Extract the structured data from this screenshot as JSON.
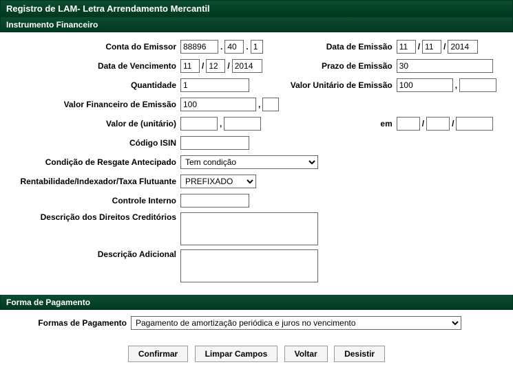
{
  "title": "Registro de LAM- Letra Arrendamento Mercantil",
  "sections": {
    "instrumento": "Instrumento Financeiro",
    "pagamento": "Forma de Pagamento"
  },
  "labels": {
    "conta_emissor": "Conta do Emissor",
    "data_emissao": "Data de Emissão",
    "data_vencimento": "Data de Vencimento",
    "prazo_emissao": "Prazo de Emissão",
    "quantidade": "Quantidade",
    "valor_unitario_emissao": "Valor Unitário de Emissão",
    "valor_financeiro_emissao": "Valor Financeiro de Emissão",
    "valor_de_unitario": "Valor de (unitário)",
    "em": "em",
    "codigo_isin": "Código ISIN",
    "condicao_resgate": "Condição de Resgate Antecipado",
    "rentabilidade": "Rentabilidade/Indexador/Taxa Flutuante",
    "controle_interno": "Controle Interno",
    "descricao_direitos": "Descrição dos Direitos Creditórios",
    "descricao_adicional": "Descrição Adicional",
    "formas_pagamento": "Formas de Pagamento"
  },
  "values": {
    "conta_emissor": {
      "p1": "88896",
      "p2": "40",
      "p3": "1"
    },
    "data_emissao": {
      "d": "11",
      "m": "11",
      "y": "2014"
    },
    "data_vencimento": {
      "d": "11",
      "m": "12",
      "y": "2014"
    },
    "prazo_emissao": "30",
    "quantidade": "1",
    "valor_unitario_emissao": {
      "int": "100",
      "dec": ""
    },
    "valor_financeiro_emissao": {
      "int": "100",
      "dec": ""
    },
    "valor_de_unitario": {
      "int": "",
      "dec": ""
    },
    "em": {
      "d": "",
      "m": "",
      "y": ""
    },
    "codigo_isin": "",
    "condicao_resgate": "Tem condição",
    "rentabilidade": "PREFIXADO",
    "controle_interno": "",
    "descricao_direitos": "",
    "descricao_adicional": "",
    "formas_pagamento": "Pagamento de amortização periódica e juros no vencimento"
  },
  "buttons": {
    "confirmar": "Confirmar",
    "limpar": "Limpar Campos",
    "voltar": "Voltar",
    "desistir": "Desistir"
  },
  "sep": {
    "dot": ".",
    "slash": "/",
    "comma": ","
  }
}
